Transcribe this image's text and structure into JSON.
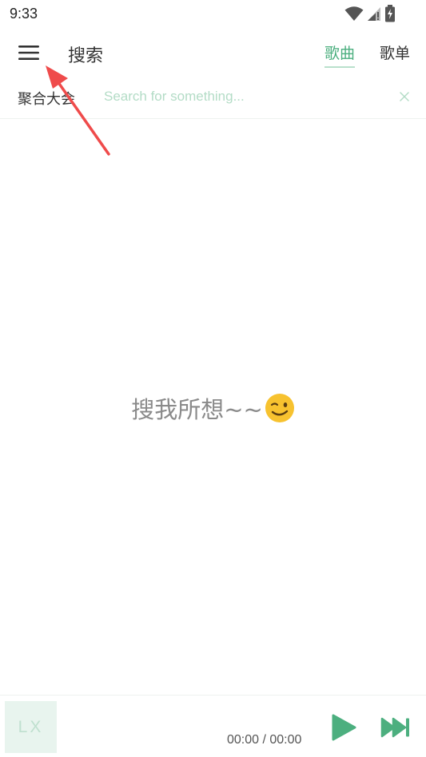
{
  "status_bar": {
    "time": "9:33",
    "icons": [
      "wifi-icon",
      "signal-icon",
      "battery-icon"
    ]
  },
  "header": {
    "menu_icon": "hamburger-menu-icon",
    "title": "搜索",
    "tabs": [
      {
        "label": "歌曲",
        "active": true
      },
      {
        "label": "歌单",
        "active": false
      }
    ]
  },
  "search": {
    "source_label": "聚合大会",
    "placeholder": "Search for something...",
    "value": "",
    "clear_icon": "close-icon"
  },
  "main": {
    "empty_message": "搜我所想~~",
    "emoji": "winking-face-icon"
  },
  "player": {
    "cover_text": "LX",
    "time": "00:00 / 00:00",
    "play_icon": "play-icon",
    "next_icon": "next-track-icon"
  },
  "colors": {
    "accent": "#4caf7f",
    "accent_light": "#b3dcc6",
    "cover_bg": "#e8f4ee",
    "annotation_arrow": "#ef4b4b"
  }
}
